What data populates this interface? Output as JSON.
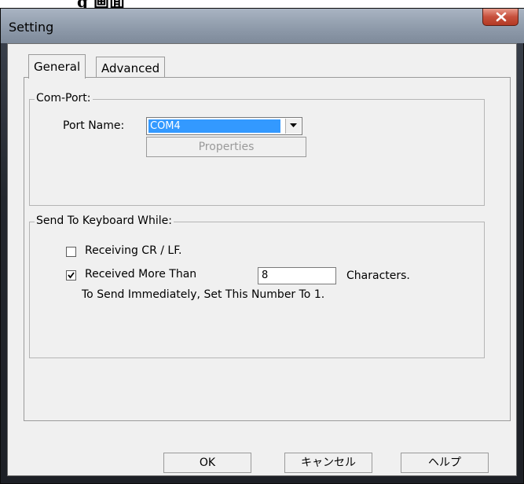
{
  "cropped_heading_fragment": "g 画面",
  "window": {
    "title": "Setting"
  },
  "tabs": [
    {
      "label": "General"
    },
    {
      "label": "Advanced"
    }
  ],
  "com_port": {
    "group_label": "Com-Port:",
    "port_name_label": "Port Name:",
    "port_name_value": "COM4",
    "properties_button": "Properties"
  },
  "send_to_keyboard": {
    "group_label": "Send To Keyboard While:",
    "receiving_crlf_label": "Receiving CR / LF.",
    "receiving_crlf_checked": false,
    "received_more_than_label": "Received More Than",
    "received_more_than_checked": true,
    "characters_value": "8",
    "characters_label": "Characters.",
    "hint": "To Send Immediately, Set This Number To 1."
  },
  "buttons": {
    "ok": "OK",
    "cancel": "キャンセル",
    "help": "ヘルプ"
  },
  "colors": {
    "selection": "#3399ff",
    "close_button": "#c7503c"
  }
}
